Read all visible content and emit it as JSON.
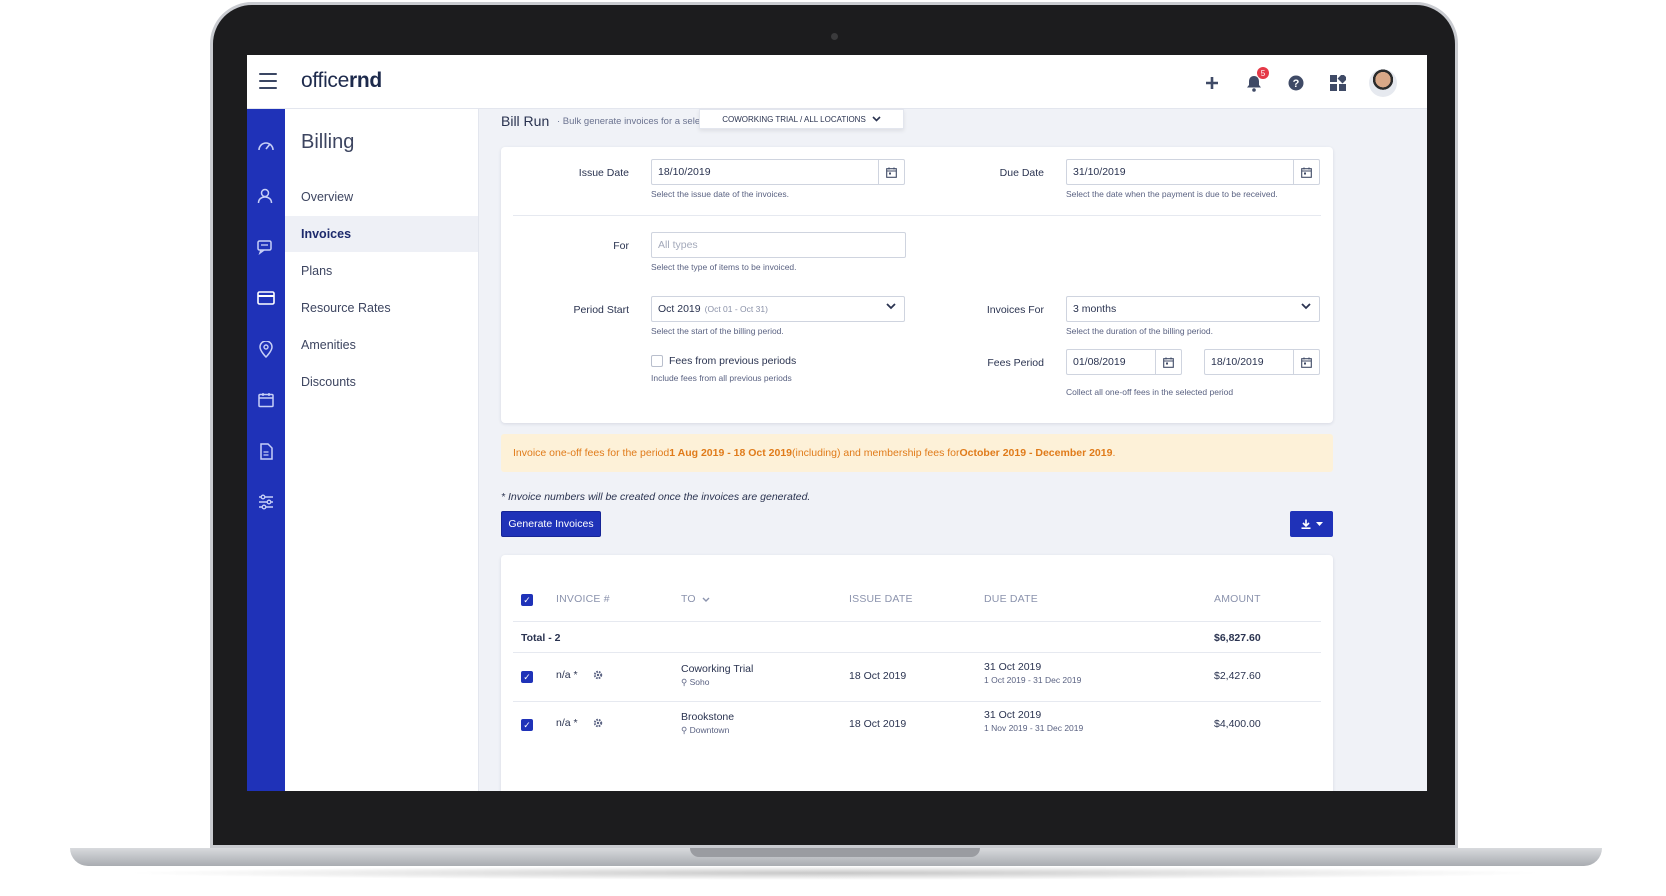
{
  "app": {
    "logo_text": "officernd",
    "brand_color": "#1f32b8",
    "notification_count": "5"
  },
  "topbar": {
    "icons": [
      "plus-icon",
      "bell-icon",
      "help-icon",
      "apps-icon"
    ]
  },
  "sidebar_icons": [
    "dashboard-icon",
    "members-icon",
    "chat-icon",
    "billing-icon",
    "location-icon",
    "calendar-icon",
    "document-icon",
    "settings-icon"
  ],
  "subnav": {
    "title": "Billing",
    "items": [
      {
        "label": "Overview"
      },
      {
        "label": "Invoices"
      },
      {
        "label": "Plans"
      },
      {
        "label": "Resource Rates"
      },
      {
        "label": "Amenities"
      },
      {
        "label": "Discounts"
      }
    ]
  },
  "header": {
    "title": "Bill Run",
    "subtitle": "· Bulk generate invoices for a selec",
    "location_selector": "COWORKING TRIAL  /  ALL LOCATIONS"
  },
  "form": {
    "issue_date_label": "Issue Date",
    "issue_date_value": "18/10/2019",
    "issue_date_help": "Select the issue date of the invoices.",
    "due_date_label": "Due Date",
    "due_date_value": "31/10/2019",
    "due_date_help": "Select the date when the payment is due to be received.",
    "for_label": "For",
    "for_placeholder": "All types",
    "for_help": "Select the type of items to be invoiced.",
    "period_start_label": "Period Start",
    "period_start_value": "Oct 2019",
    "period_start_range": "(Oct 01 - Oct 31)",
    "period_start_help": "Select the start of the billing period.",
    "invoices_for_label": "Invoices For",
    "invoices_for_value": "3 months",
    "invoices_for_help": "Select the duration of the billing period.",
    "fees_prev_label": "Fees from previous periods",
    "fees_prev_help": "Include fees from all previous periods",
    "fees_period_label": "Fees Period",
    "fees_period_from": "01/08/2019",
    "fees_period_to": "18/10/2019",
    "fees_period_help": "Collect all one-off fees in the selected period"
  },
  "notice": {
    "part1": "Invoice one-off fees for the period ",
    "period": "1 Aug 2019 - 18 Oct 2019",
    "part2": " (including) and membership fees for ",
    "membership": "October 2019 - December 2019",
    "part3": " ."
  },
  "note": "* Invoice numbers will be created once the invoices are generated.",
  "actions": {
    "generate_label": "Generate Invoices"
  },
  "table": {
    "columns": [
      "INVOICE #",
      "TO",
      "ISSUE DATE",
      "DUE DATE",
      "AMOUNT"
    ],
    "total_label": "Total - 2",
    "total_amount": "$6,827.60",
    "rows": [
      {
        "invoice": "n/a *",
        "to": "Coworking Trial",
        "location": "Soho",
        "issue_date": "18 Oct 2019",
        "due_date": "31 Oct 2019",
        "period": "1 Oct 2019 - 31 Dec 2019",
        "amount": "$2,427.60"
      },
      {
        "invoice": "n/a *",
        "to": "Brookstone",
        "location": "Downtown",
        "issue_date": "18 Oct 2019",
        "due_date": "31 Oct 2019",
        "period": "1 Nov 2019 - 31 Dec 2019",
        "amount": "$4,400.00"
      }
    ]
  }
}
